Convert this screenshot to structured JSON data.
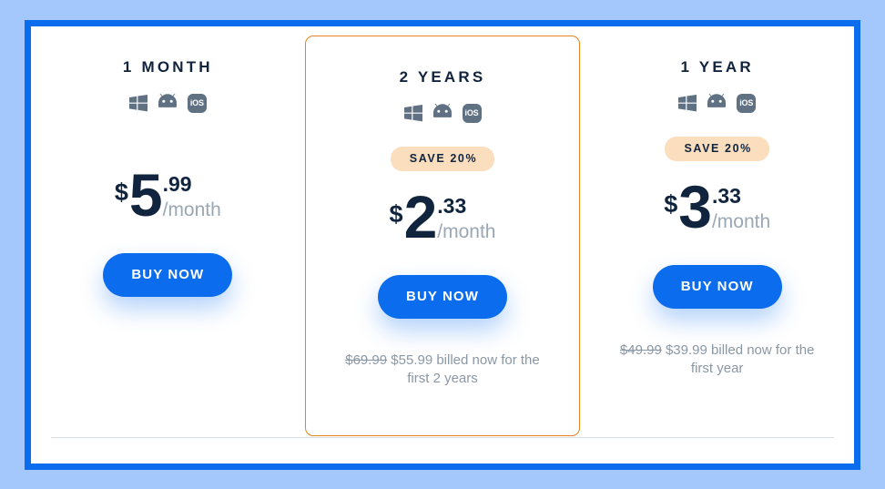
{
  "theme": {
    "page_background": "#a4c8fb",
    "frame_border": "#0b6ced",
    "panel_background": "#ffffff",
    "featured_border": "#e8821e",
    "badge_background": "#fbdebd",
    "title_color": "#10243e",
    "muted_text": "#8a97a4",
    "button_color": "#0b6ced",
    "os_icon_color": "#5f7183"
  },
  "os_icons": [
    {
      "name": "windows-icon",
      "label": "Windows"
    },
    {
      "name": "android-icon",
      "label": "Android"
    },
    {
      "name": "ios-icon",
      "label": "iOS"
    }
  ],
  "plans": [
    {
      "id": "1-month",
      "title": "1 MONTH",
      "featured": false,
      "badge": "",
      "currency": "$",
      "price_int": "5",
      "price_cents": ".99",
      "period": "/month",
      "cta": "BUY NOW",
      "billing_old_price": "",
      "billing_text": ""
    },
    {
      "id": "2-years",
      "title": "2 YEARS",
      "featured": true,
      "badge": "SAVE 20%",
      "currency": "$",
      "price_int": "2",
      "price_cents": ".33",
      "period": "/month",
      "cta": "BUY NOW",
      "billing_old_price": "$69.99",
      "billing_text": "$55.99 billed now for the first 2 years"
    },
    {
      "id": "1-year",
      "title": "1 YEAR",
      "featured": false,
      "badge": "SAVE 20%",
      "currency": "$",
      "price_int": "3",
      "price_cents": ".33",
      "period": "/month",
      "cta": "BUY NOW",
      "billing_old_price": "$49.99",
      "billing_text": "$39.99 billed now for the first year"
    }
  ]
}
